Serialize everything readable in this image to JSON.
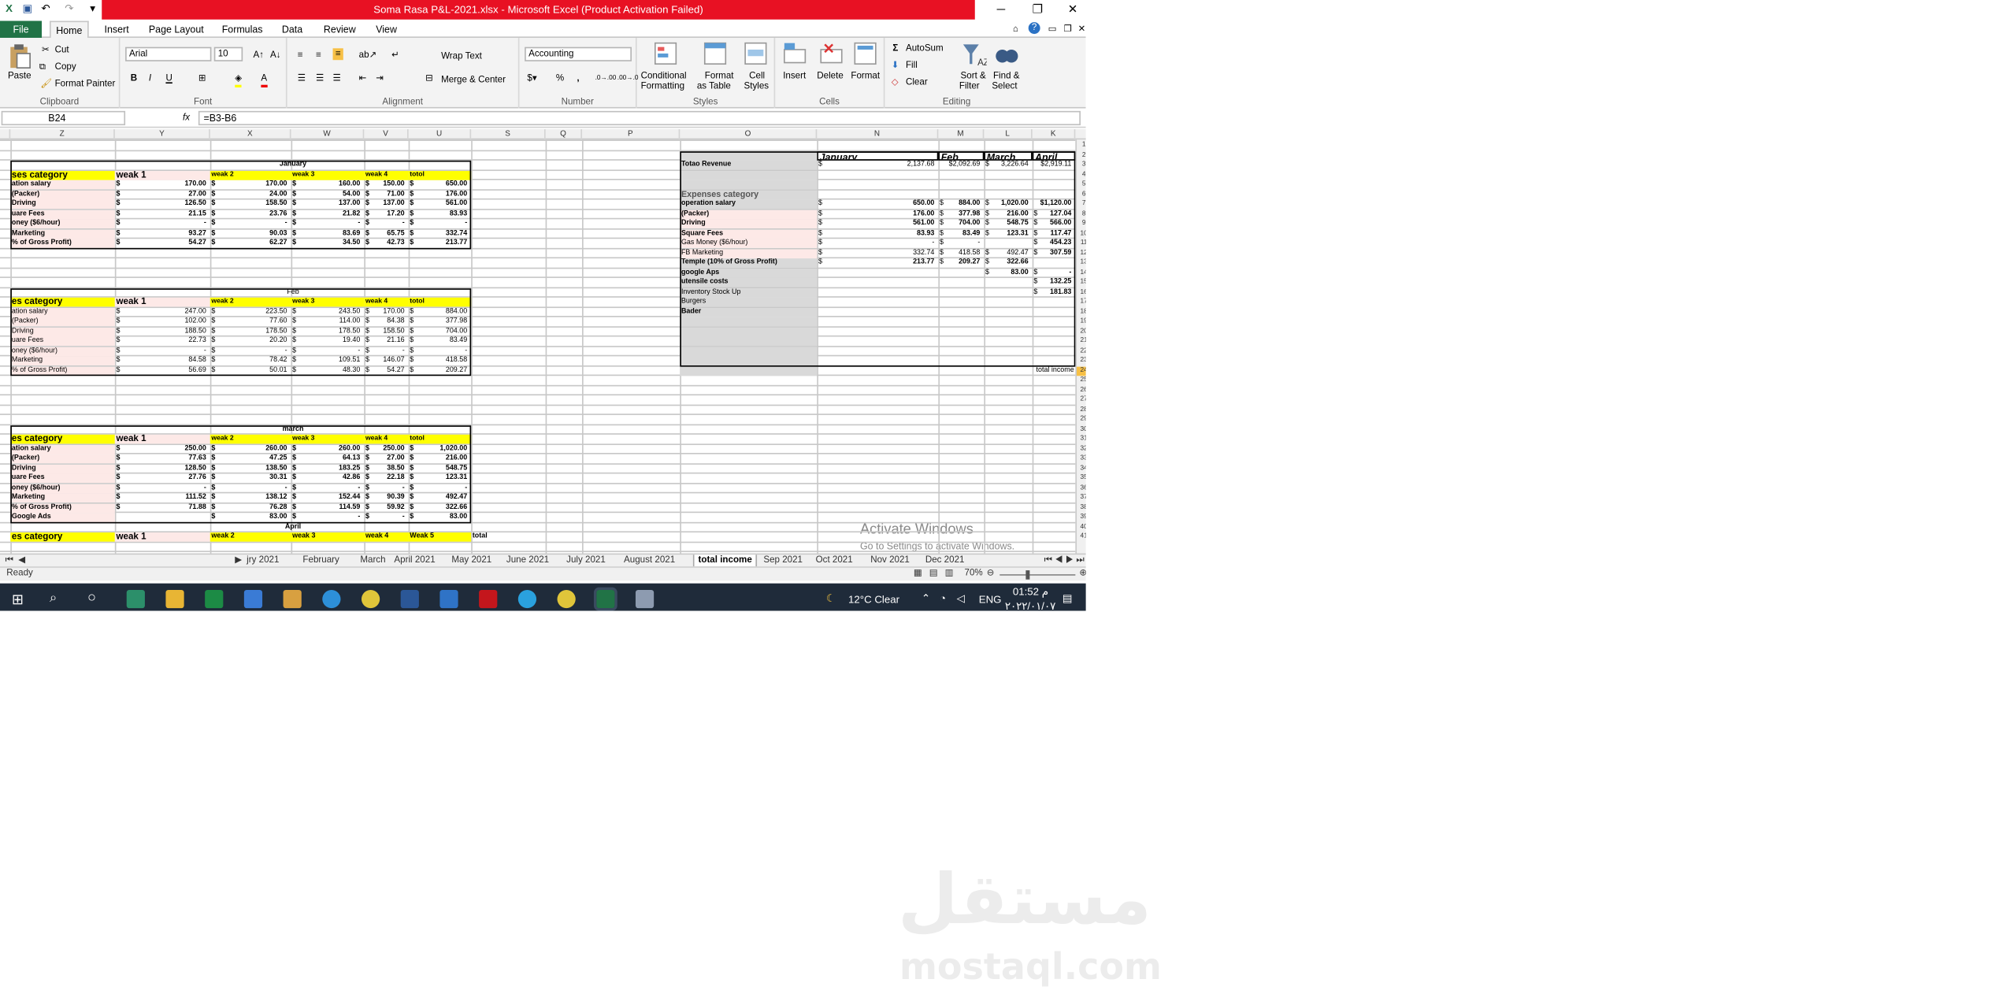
{
  "window": {
    "title": "Soma Rasa P&L-2021.xlsx  -  Microsoft Excel (Product Activation Failed)",
    "minimize": "─",
    "restore": "❐",
    "close": "✕"
  },
  "tabs": [
    {
      "label": "File"
    },
    {
      "label": "Home"
    },
    {
      "label": "Insert"
    },
    {
      "label": "Page Layout"
    },
    {
      "label": "Formulas"
    },
    {
      "label": "Data"
    },
    {
      "label": "Review"
    },
    {
      "label": "View"
    }
  ],
  "ribbon": {
    "clipboard": {
      "label": "Clipboard",
      "paste": "Paste",
      "cut": "Cut",
      "copy": "Copy",
      "format_painter": "Format Painter"
    },
    "font": {
      "label": "Font",
      "family": "Arial",
      "size": "10",
      "bold": "B",
      "italic": "I",
      "underline": "U"
    },
    "alignment": {
      "label": "Alignment",
      "wrap": "Wrap Text",
      "merge": "Merge & Center"
    },
    "number": {
      "label": "Number",
      "format": "Accounting",
      "percent": "%",
      "comma": ","
    },
    "styles": {
      "label": "Styles",
      "cond": "Conditional",
      "cond2": "Formatting",
      "table": "Format",
      "table2": "as Table",
      "cell": "Cell",
      "cell2": "Styles"
    },
    "cells": {
      "label": "Cells",
      "insert": "Insert",
      "delete": "Delete",
      "format": "Format"
    },
    "editing": {
      "label": "Editing",
      "autosum": "AutoSum",
      "fill": "Fill",
      "clear": "Clear",
      "sort": "Sort &",
      "sort2": "Filter",
      "find": "Find &",
      "find2": "Select"
    }
  },
  "formula_bar": {
    "name_box": "B24",
    "fx": "fx",
    "formula": "=B3-B6"
  },
  "columns": [
    "Z",
    "Y",
    "X",
    "W",
    "V",
    "U",
    "S",
    "Q",
    "P",
    "O",
    "N",
    "M",
    "L",
    "K"
  ],
  "rows": [
    "1",
    "2",
    "3",
    "4",
    "5",
    "6",
    "7",
    "8",
    "9",
    "10",
    "11",
    "12",
    "13",
    "14",
    "15",
    "16",
    "17",
    "18",
    "19",
    "20",
    "21",
    "22",
    "23",
    "24",
    "25",
    "26",
    "27",
    "28",
    "29",
    "30",
    "31",
    "32",
    "33",
    "34",
    "35",
    "36",
    "37",
    "38",
    "39",
    "40",
    "41"
  ],
  "months_left": [
    {
      "title": "January",
      "header": [
        "ses category",
        "weak 1",
        "weak 2",
        "weak 3",
        "weak 4",
        "totol"
      ],
      "rows": [
        {
          "label": "ation salary",
          "v": [
            "170.00",
            "170.00",
            "160.00",
            "150.00",
            "650.00"
          ]
        },
        {
          "label": "(Packer)",
          "v": [
            "27.00",
            "24.00",
            "54.00",
            "71.00",
            "176.00"
          ]
        },
        {
          "label": "Driving",
          "v": [
            "126.50",
            "158.50",
            "137.00",
            "137.00",
            "561.00"
          ]
        },
        {
          "label": "uare Fees",
          "v": [
            "21.15",
            "23.76",
            "21.82",
            "17.20",
            "83.93"
          ]
        },
        {
          "label": "oney ($6/hour)",
          "v": [
            "-",
            "-",
            "-",
            "-",
            "-"
          ]
        },
        {
          "label": "Marketing",
          "v": [
            "93.27",
            "90.03",
            "83.69",
            "65.75",
            "332.74"
          ]
        },
        {
          "label": "% of Gross Profit)",
          "v": [
            "54.27",
            "62.27",
            "34.50",
            "42.73",
            "213.77"
          ]
        }
      ]
    },
    {
      "title": "Feb",
      "header": [
        "es category",
        "weak 1",
        "weak 2",
        "weak 3",
        "weak 4",
        "totol"
      ],
      "rows": [
        {
          "label": "ation salary",
          "v": [
            "247.00",
            "223.50",
            "243.50",
            "170.00",
            "884.00"
          ]
        },
        {
          "label": "(Packer)",
          "v": [
            "102.00",
            "77.60",
            "114.00",
            "84.38",
            "377.98"
          ]
        },
        {
          "label": "Driving",
          "v": [
            "188.50",
            "178.50",
            "178.50",
            "158.50",
            "704.00"
          ]
        },
        {
          "label": "uare Fees",
          "v": [
            "22.73",
            "20.20",
            "19.40",
            "21.16",
            "83.49"
          ]
        },
        {
          "label": "oney ($6/hour)",
          "v": [
            "-",
            "-",
            "-",
            "-",
            "-"
          ]
        },
        {
          "label": "Marketing",
          "v": [
            "84.58",
            "78.42",
            "109.51",
            "146.07",
            "418.58"
          ]
        },
        {
          "label": "% of Gross Profit)",
          "v": [
            "56.69",
            "50.01",
            "48.30",
            "54.27",
            "209.27"
          ]
        }
      ]
    },
    {
      "title": "march",
      "header": [
        "es category",
        "weak 1",
        "weak 2",
        "weak 3",
        "weak 4",
        "totol"
      ],
      "rows": [
        {
          "label": "ation salary",
          "v": [
            "250.00",
            "260.00",
            "260.00",
            "250.00",
            "1,020.00"
          ]
        },
        {
          "label": "(Packer)",
          "v": [
            "77.63",
            "47.25",
            "64.13",
            "27.00",
            "216.00"
          ]
        },
        {
          "label": "Driving",
          "v": [
            "128.50",
            "138.50",
            "183.25",
            "38.50",
            "548.75"
          ]
        },
        {
          "label": "uare Fees",
          "v": [
            "27.76",
            "30.31",
            "42.86",
            "22.18",
            "123.31"
          ]
        },
        {
          "label": "oney ($6/hour)",
          "v": [
            "-",
            "-",
            "-",
            "-",
            "-"
          ]
        },
        {
          "label": "Marketing",
          "v": [
            "111.52",
            "138.12",
            "152.44",
            "90.39",
            "492.47"
          ]
        },
        {
          "label": "% of Gross Profit)",
          "v": [
            "71.88",
            "76.28",
            "114.59",
            "59.92",
            "322.66"
          ]
        },
        {
          "label": "Google Ads",
          "v": [
            "",
            "83.00",
            "-",
            "-",
            "83.00"
          ]
        }
      ]
    }
  ],
  "april_block": {
    "title": "April",
    "header": [
      "es category",
      "weak 1",
      "weak 2",
      "weak 3",
      "weak 4",
      "Weak 5",
      "total"
    ]
  },
  "summary": {
    "months": [
      "January",
      "Feb",
      "March",
      "April"
    ],
    "revenue_label": "Totao Revenue",
    "revenue": [
      "2,137.68",
      "$2,092.69",
      "3,226.64",
      "$2,919.11"
    ],
    "exp_header": "Expenses category",
    "rows": [
      {
        "label": "operation salary",
        "v": [
          "650.00",
          "884.00",
          "1,020.00",
          "$1,120.00"
        ]
      },
      {
        "label": "(Packer)",
        "v": [
          "176.00",
          "377.98",
          "216.00",
          "127.04"
        ]
      },
      {
        "label": "Driving",
        "v": [
          "561.00",
          "704.00",
          "548.75",
          "566.00"
        ]
      },
      {
        "label": "Square Fees",
        "v": [
          "83.93",
          "83.49",
          "123.31",
          "117.47"
        ]
      },
      {
        "label": "Gas Money ($6/hour)",
        "v": [
          "-",
          "-",
          "",
          "454.23"
        ]
      },
      {
        "label": "FB Marketing",
        "v": [
          "332.74",
          "418.58",
          "492.47",
          "307.59"
        ]
      },
      {
        "label": "Temple (10% of Gross Profit)",
        "v": [
          "213.77",
          "209.27",
          "322.66",
          ""
        ]
      },
      {
        "label": "google Aps",
        "v": [
          "",
          "",
          "83.00",
          "-"
        ]
      },
      {
        "label": "utensile costs",
        "v": [
          "",
          "",
          "",
          "132.25"
        ]
      },
      {
        "label": "Inventory Stock Up",
        "v": [
          "",
          "",
          "",
          "181.83"
        ]
      },
      {
        "label": "Burgers",
        "v": [
          "",
          "",
          "",
          ""
        ]
      },
      {
        "label": "Bader",
        "v": [
          "",
          "",
          "",
          ""
        ]
      }
    ],
    "total_income": "total income"
  },
  "activate": {
    "line1": "Activate Windows",
    "line2": "Go to Settings to activate Windows."
  },
  "sheet_tabs": [
    "jry 2021",
    "February",
    "March",
    "April 2021",
    "May 2021",
    "June 2021",
    "July 2021",
    "August 2021",
    "total income",
    "Sep 2021",
    "Oct 2021",
    "Nov 2021",
    "Dec 2021"
  ],
  "status": {
    "ready": "Ready",
    "zoom": "70%"
  },
  "taskbar": {
    "weather": "12°C  Clear",
    "lang": "ENG",
    "time": "01:52 م",
    "date": "٢٠٢٢/٠١/٠٧"
  },
  "watermark": {
    "arabic": "مستقل",
    "latin": "mostaql.com"
  }
}
